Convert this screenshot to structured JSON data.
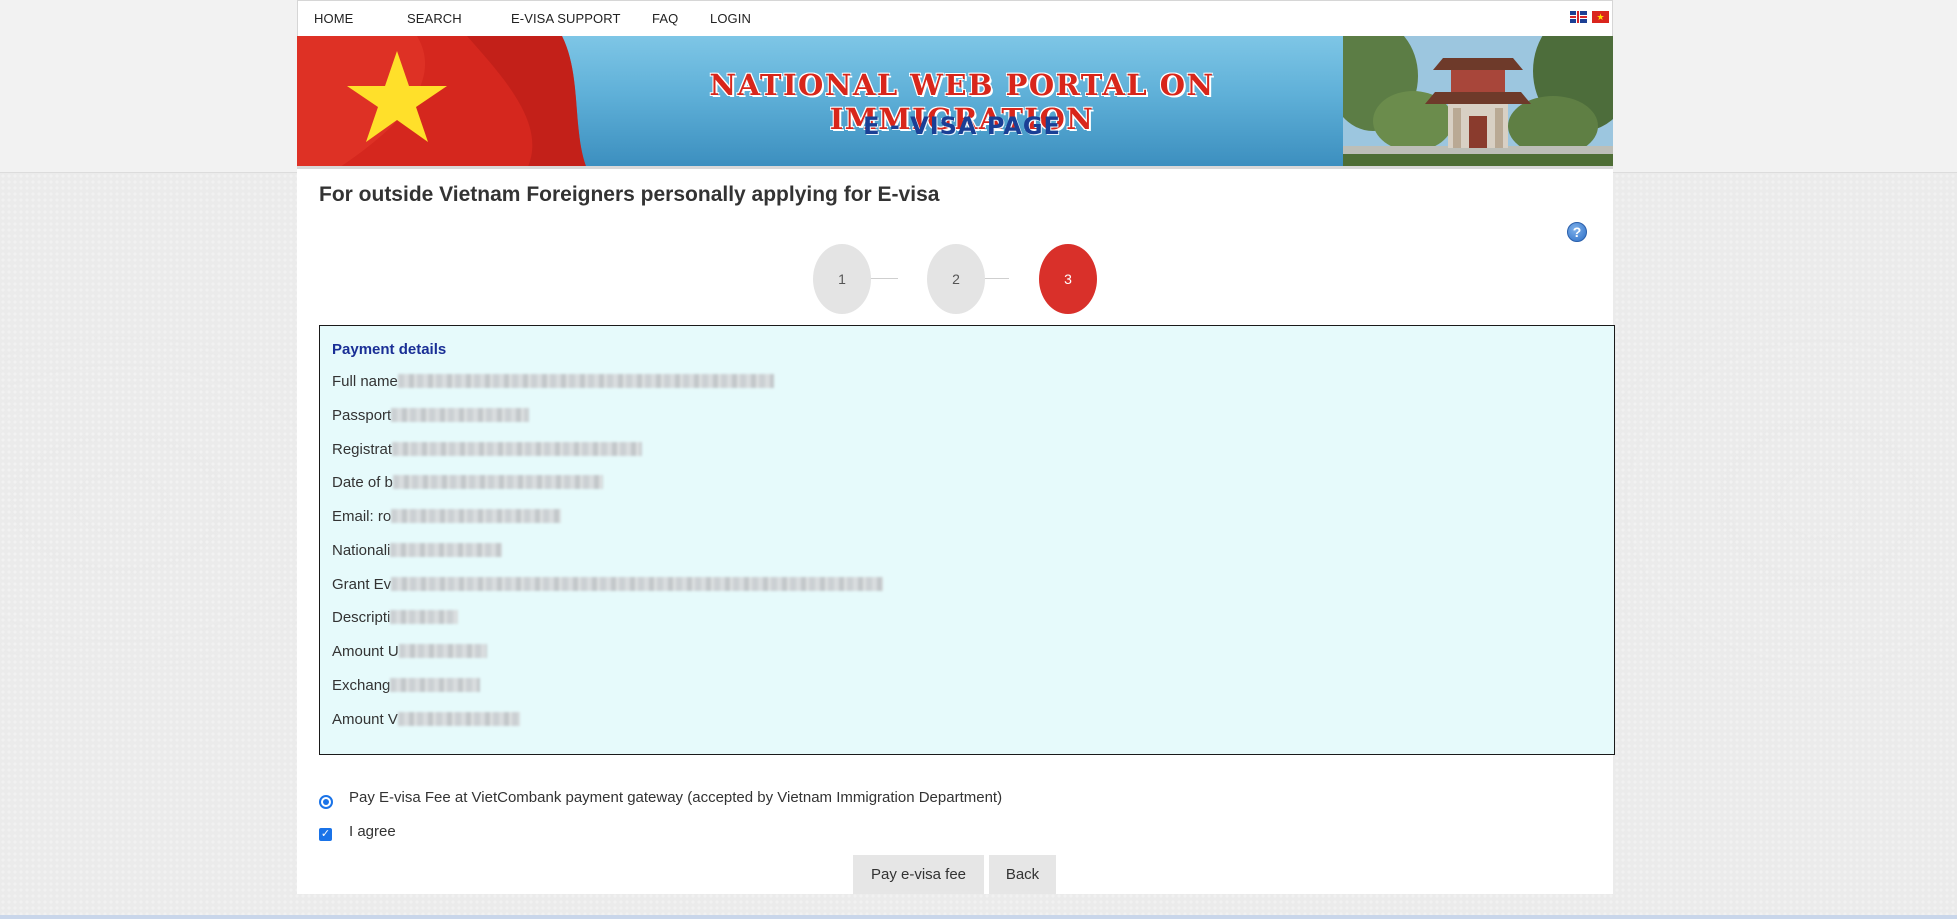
{
  "nav": {
    "items": [
      "HOME",
      "SEARCH",
      "E-VISA SUPPORT",
      "FAQ",
      "LOGIN"
    ],
    "flags": [
      "uk-flag-icon",
      "vietnam-flag-icon"
    ]
  },
  "banner": {
    "title": "NATIONAL WEB PORTAL ON IMMIGRATION",
    "subtitle": "E - VISA PAGE"
  },
  "page": {
    "title": "For outside Vietnam Foreigners personally applying for E-visa",
    "help_icon": "?"
  },
  "stepper": {
    "steps": [
      "1",
      "2",
      "3"
    ],
    "active_step": "3"
  },
  "payment": {
    "heading": "Payment details",
    "rows": [
      "Full name",
      "Passport",
      "Registrat",
      "Date of b",
      "Email: ro",
      "Nationali",
      "Grant Ev",
      "Descripti",
      "Amount U",
      "Exchang",
      "Amount V"
    ]
  },
  "options": {
    "gateway_label": "Pay E-visa Fee at VietCombank payment gateway (accepted by Vietnam Immigration Department)",
    "agree_label": "I agree"
  },
  "buttons": {
    "pay": "Pay e-visa fee",
    "back": "Back"
  },
  "colors": {
    "accent_red": "#d9302a",
    "heading_blue": "#1a2f96",
    "panel_bg": "#e6fafb",
    "control_blue": "#1a73e8"
  }
}
